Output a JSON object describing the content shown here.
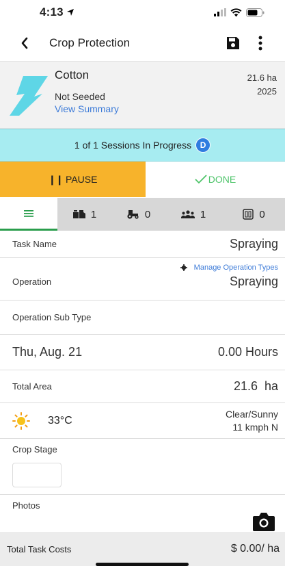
{
  "status_bar": {
    "time": "4:13"
  },
  "header": {
    "title": "Crop Protection"
  },
  "crop": {
    "name": "Cotton",
    "status": "Not Seeded",
    "summary_link": "View Summary",
    "area": "21.6 ha",
    "year": "2025"
  },
  "sessions": {
    "text": "1 of 1 Sessions In Progress",
    "badge": "D"
  },
  "actions": {
    "pause_label": "PAUSE",
    "done_label": "DONE"
  },
  "tabs": [
    {
      "icon": "list-icon",
      "count": ""
    },
    {
      "icon": "product-icon",
      "count": "1"
    },
    {
      "icon": "tractor-icon",
      "count": "0"
    },
    {
      "icon": "people-icon",
      "count": "1"
    },
    {
      "icon": "calculator-icon",
      "count": "0"
    }
  ],
  "form": {
    "task_name_label": "Task Name",
    "task_name_value": "Spraying",
    "manage_link": "Manage Operation Types",
    "operation_label": "Operation",
    "operation_value": "Spraying",
    "subtype_label": "Operation Sub Type",
    "date_value": "Thu, Aug. 21",
    "hours_value": "0.00 Hours",
    "total_area_label": "Total Area",
    "total_area_value": "21.6  ha",
    "weather_temp": "33°C",
    "weather_condition": "Clear/Sunny",
    "weather_wind": "11 kmph N",
    "crop_stage_label": "Crop Stage",
    "photos_label": "Photos"
  },
  "costs": {
    "label": "Total Task Costs",
    "value": "$ 0.00/ ha"
  },
  "colors": {
    "accent_orange": "#f7b32b",
    "accent_green": "#4ec46a",
    "session_cyan": "#a7ecf1",
    "link_blue": "#3d7bd8",
    "crop_icon_cyan": "#5ed6e6"
  }
}
